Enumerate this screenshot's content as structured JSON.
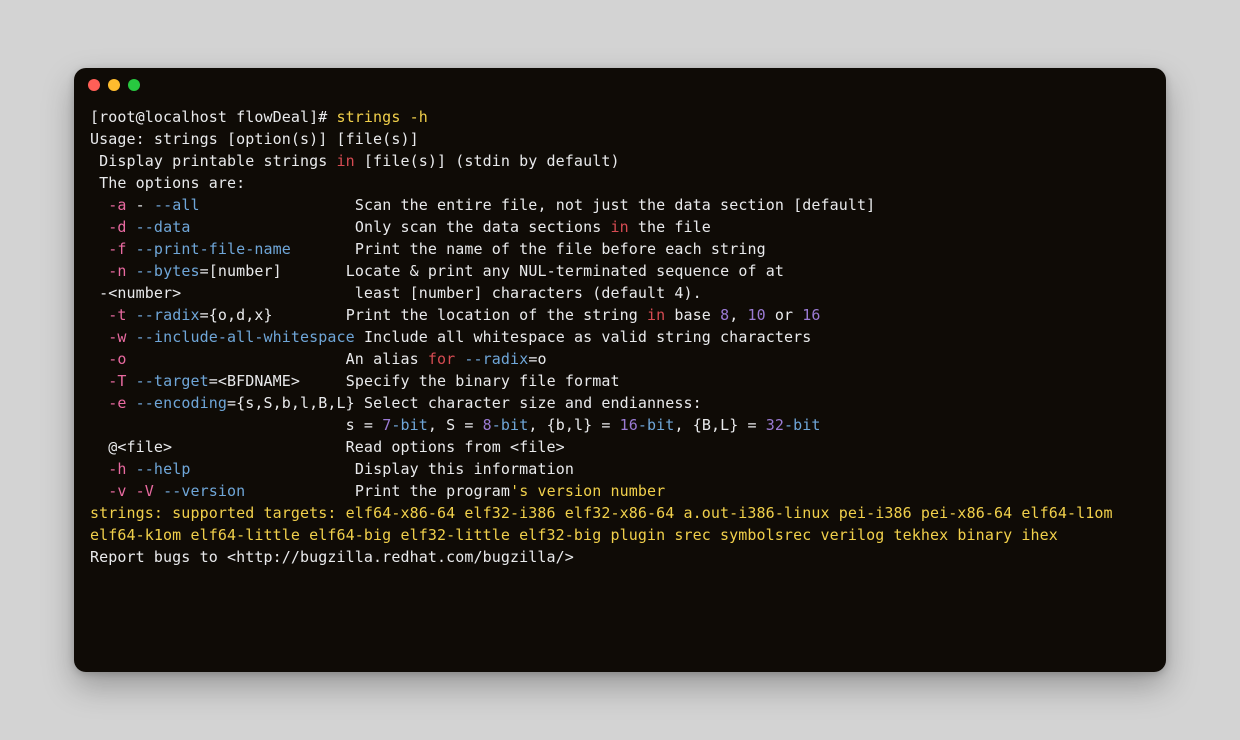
{
  "prompt": {
    "text": "[root@localhost flowDeal]# "
  },
  "command": {
    "name": "strings",
    "arg": "-h"
  },
  "usage": "Usage: strings [option(s)] [file(s)]",
  "desc": {
    "pre": " Display printable strings ",
    "kw": "in",
    "post": " [file(s)] (stdin by default)"
  },
  "opts_header": " The options are:",
  "lines": {
    "a": {
      "short": "-a",
      "dash": " - ",
      "long": "--all",
      "pad": "                 ",
      "text": "Scan the entire file, not just the data section [default]"
    },
    "d": {
      "short": "-d",
      "sp": " ",
      "long": "--data",
      "pad": "                  ",
      "pre": "Only scan the data sections ",
      "kw": "in",
      "post": " the file"
    },
    "f": {
      "short": "-f",
      "sp": " ",
      "long": "--print-file-name",
      "pad": "       ",
      "text": "Print the name of the file before each string"
    },
    "n": {
      "short": "-n",
      "sp": " ",
      "long": "--bytes",
      "param": "=[number]",
      "pad": "       ",
      "text": "Locate & print any NUL-terminated sequence of at"
    },
    "n2": {
      "lead": " -<number>                   ",
      "text": "least [number] characters (default 4)."
    },
    "t": {
      "short": "-t",
      "sp": " ",
      "long": "--radix",
      "param": "={o,d,x}",
      "pad": "        ",
      "pre": "Print the location of the string ",
      "kw": "in",
      "mid": " base ",
      "n1": "8",
      "c1": ", ",
      "n2": "10",
      "c2": " or ",
      "n3": "16"
    },
    "w": {
      "short": "-w",
      "sp": " ",
      "long": "--include-all-whitespace",
      "pad": " ",
      "text": "Include all whitespace as valid string characters"
    },
    "o": {
      "short": "-o",
      "pad": "                        ",
      "pre": "An alias ",
      "kw": "for",
      "sp2": " ",
      "long": "--radix",
      "post": "=o"
    },
    "T": {
      "short": "-T",
      "sp": " ",
      "long": "--target",
      "param": "=<BFDNAME>",
      "pad": "     ",
      "text": "Specify the binary file format"
    },
    "e": {
      "short": "-e",
      "sp": " ",
      "long": "--encoding",
      "param": "={s,S,b,l,B,L}",
      "pad": " ",
      "text": "Select character size and endianness:"
    },
    "e2": {
      "lead": "                            s = ",
      "v1": "7",
      "u1": "-bit",
      "m1": ", S = ",
      "v2": "8",
      "u2": "-bit",
      "m2": ", {b,l} = ",
      "v3": "16",
      "u3": "-bit",
      "m3": ", {B,L} = ",
      "v4": "32",
      "u4": "-bit"
    },
    "at": {
      "lead": "  @<file>                   ",
      "text": "Read options from <file>"
    },
    "h": {
      "short": "-h",
      "sp": " ",
      "long": "--help",
      "pad": "                  ",
      "text": "Display this information"
    },
    "v": {
      "short": "-v",
      "sp1": " ",
      "short2": "-V",
      "sp2": " ",
      "long": "--version",
      "pad": "            ",
      "pre": "Print the program",
      "str": "'s version number"
    }
  },
  "targets": {
    "label": "strings: supported targets: ",
    "list": "elf64-x86-64 elf32-i386 elf32-x86-64 a.out-i386-linux pei-i386 pei-x86-64 elf64-l1om elf64-k1om elf64-little elf64-big elf32-little elf32-big plugin srec symbolsrec verilog tekhex binary ihex"
  },
  "bugs": "Report bugs to <http://bugzilla.redhat.com/bugzilla/>"
}
